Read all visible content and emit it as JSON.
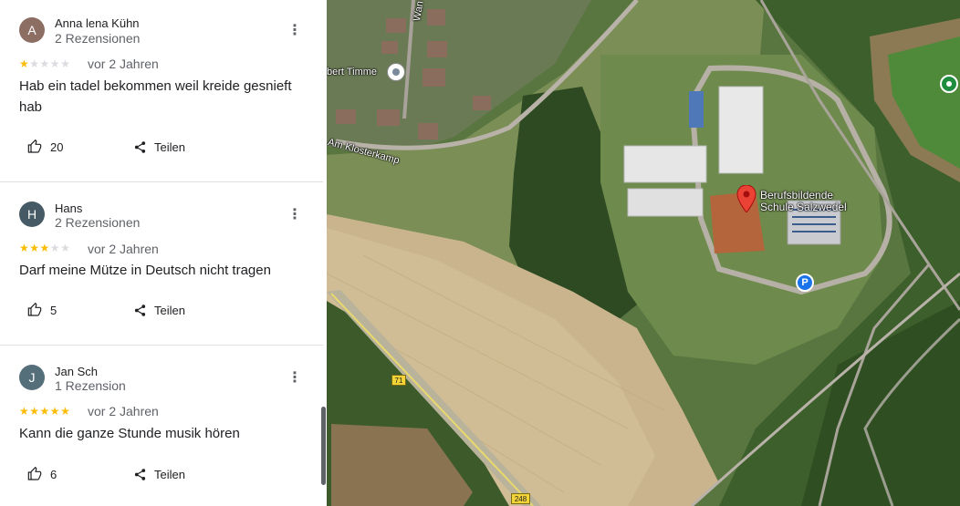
{
  "reviews": [
    {
      "initial": "A",
      "avatar_color": "#8d6e63",
      "author": "Anna lena Kühn",
      "count": "2 Rezensionen",
      "rating": 1,
      "date": "vor 2 Jahren",
      "text": "Hab ein tadel bekommen weil kreide gesnieft hab",
      "likes": "20",
      "share_label": "Teilen"
    },
    {
      "initial": "H",
      "avatar_color": "#455a64",
      "author": "Hans",
      "count": "2 Rezensionen",
      "rating": 3,
      "date": "vor 2 Jahren",
      "text": "Darf meine Mütze in Deutsch nicht tragen",
      "likes": "5",
      "share_label": "Teilen"
    },
    {
      "initial": "J",
      "avatar_color": "#546e7a",
      "author": "Jan Sch",
      "count": "1 Rezension",
      "rating": 5,
      "date": "vor 2 Jahren",
      "text": "Kann die ganze Stunde musik hören",
      "likes": "6",
      "share_label": "Teilen"
    }
  ],
  "map": {
    "place_label": "Berufsbildende\nSchule Salzwedel",
    "street_label": "Am Klosterkamp",
    "partial_label": "bert Timme",
    "street_top": "Wan",
    "road_shield_71": "71",
    "road_shield_248": "248",
    "parking_label": "P",
    "pin_color": "#ea4335",
    "parking_color": "#1a73e8",
    "poi_green_color": "#1e8e3e"
  }
}
